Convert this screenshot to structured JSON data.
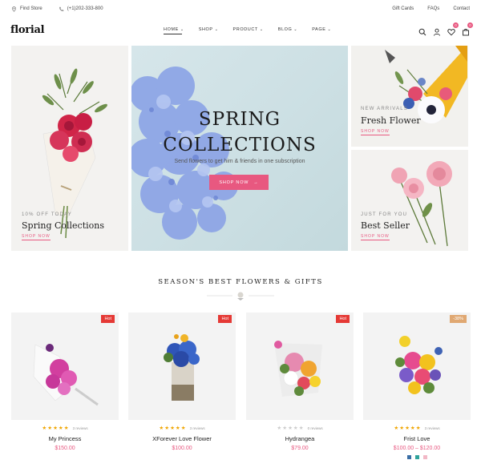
{
  "topbar": {
    "find_store": "Find Store",
    "phone": "(+1)202-333-800",
    "links": [
      "Gift Cards",
      "FAQs",
      "Contact"
    ]
  },
  "header": {
    "logo": "florial",
    "nav": [
      {
        "label": "HOME",
        "active": true
      },
      {
        "label": "SHOP"
      },
      {
        "label": "PRODUCT"
      },
      {
        "label": "BLOG"
      },
      {
        "label": "PAGE"
      }
    ],
    "wishlist_count": "0",
    "cart_count": "0"
  },
  "hero": {
    "left": {
      "eyebrow": "10% OFF TODAY",
      "title": "Spring Collections",
      "link": "SHOP NOW"
    },
    "main": {
      "title_line1": "SPRING",
      "title_line2": "COLLECTIONS",
      "subtitle": "Send flowers to get him & friends in one subscription",
      "button": "SHOP NOW"
    },
    "right_top": {
      "eyebrow": "NEW ARRIVALS",
      "title": "Fresh Flower",
      "link": "SHOP NOW"
    },
    "right_bottom": {
      "eyebrow": "JUST FOR YOU",
      "title": "Best Seller",
      "link": "SHOP NOW"
    }
  },
  "section": {
    "title": "SEASON'S BEST FLOWERS & GIFTS"
  },
  "products": [
    {
      "name": "My Princess",
      "price": "$150.00",
      "tag": "Hot",
      "tag_color": "#e53935",
      "stars": "★★★★★",
      "rating_filled": true,
      "reviews": "3 reviews"
    },
    {
      "name": "XForever Love Flower",
      "price": "$100.00",
      "tag": "Hot",
      "tag_color": "#e53935",
      "stars": "★★★★★",
      "rating_filled": true,
      "reviews": "3 reviews"
    },
    {
      "name": "Hydrangea",
      "price": "$79.00",
      "tag": "Hot",
      "tag_color": "#e53935",
      "stars": "★★★★★",
      "rating_filled": false,
      "reviews": "0 reviews"
    },
    {
      "name": "Frist Love",
      "price": "$100.00 – $120.00",
      "tag": "-38%",
      "tag_color": "#e0a872",
      "stars": "★★★★★",
      "rating_filled": true,
      "reviews": "3 reviews",
      "swatches": [
        "#3a6ea5",
        "#2fa39a",
        "#f2b8c6"
      ]
    }
  ],
  "colors": {
    "accent": "#e85880",
    "hot": "#e53935",
    "sale": "#e0a872"
  }
}
